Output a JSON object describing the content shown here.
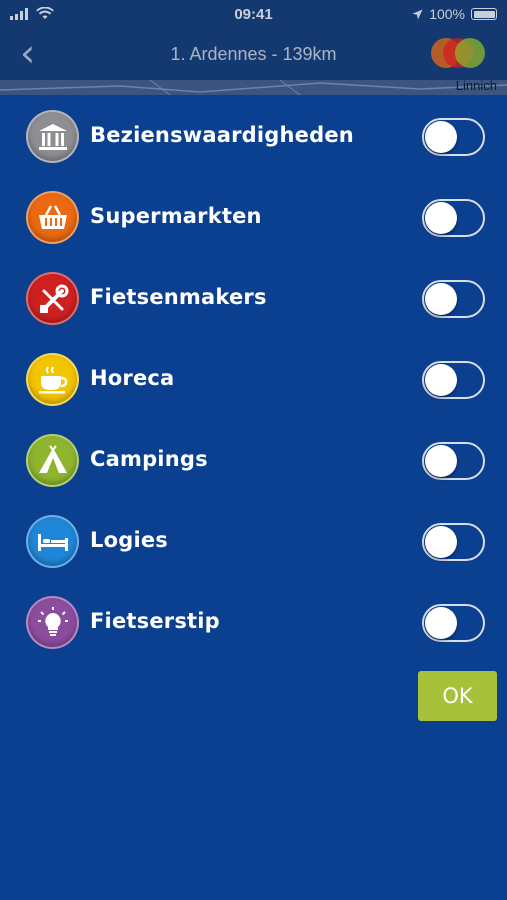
{
  "status_bar": {
    "time": "09:41",
    "battery": "100%"
  },
  "nav": {
    "back_label": "‹",
    "title": "1. Ardennes - 139km"
  },
  "map": {
    "place": "Linnich"
  },
  "items": [
    {
      "label": "Bezienswaardigheden",
      "icon": "museum-icon",
      "color": "#8d8f93",
      "enabled": false
    },
    {
      "label": "Supermarkten",
      "icon": "shopping-basket-icon",
      "color": "#ea6a12",
      "enabled": false
    },
    {
      "label": "Fietsenmakers",
      "icon": "bike-repair-icon",
      "color": "#cf2020",
      "enabled": false
    },
    {
      "label": "Horeca",
      "icon": "coffee-cup-icon",
      "color": "#f3c400",
      "enabled": false
    },
    {
      "label": "Campings",
      "icon": "tent-icon",
      "color": "#8fb52e",
      "enabled": false
    },
    {
      "label": "Logies",
      "icon": "bed-icon",
      "color": "#1f86d8",
      "enabled": false
    },
    {
      "label": "Fietserstip",
      "icon": "lightbulb-icon",
      "color": "#8d4d9f",
      "enabled": false
    }
  ],
  "ok_label": "OK"
}
